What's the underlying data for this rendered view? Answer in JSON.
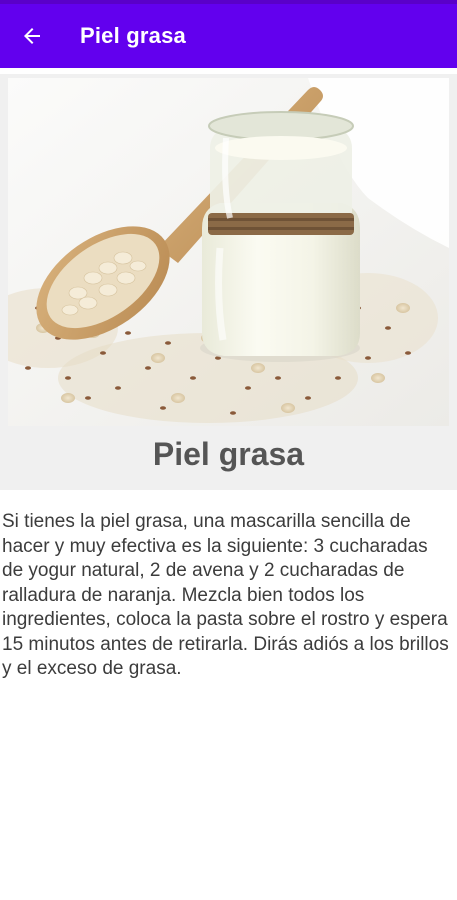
{
  "app_bar": {
    "title": "Piel grasa",
    "back_icon": "arrow-back-icon",
    "color": "#6200ee"
  },
  "hero": {
    "image": "jar-of-yogurt-with-oats-and-flaxseed-on-wooden-spoon"
  },
  "article": {
    "title": "Piel grasa",
    "body": "Si tienes la piel grasa, una mascarilla sencilla de hacer y muy efectiva es la siguiente: 3 cucharadas de yogur natural, 2 de avena y 2 cucharadas de ralladura de naranja. Mezcla bien todos los ingredientes, coloca la pasta sobre el rostro y espera 15 minutos antes de retirarla. Dirás adiós a los brillos y el exceso de grasa."
  }
}
